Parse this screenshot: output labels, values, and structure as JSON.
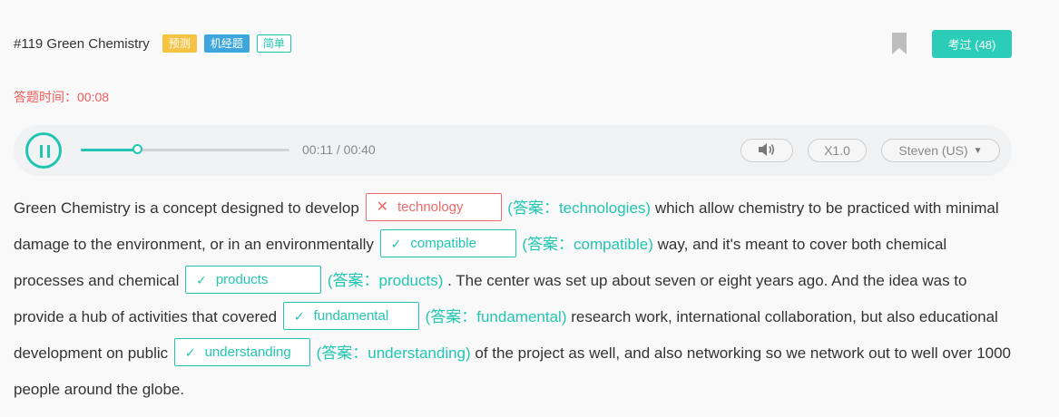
{
  "header": {
    "title": "#119 Green Chemistry",
    "tags": [
      {
        "label": "预测",
        "type": "predict"
      },
      {
        "label": "机经题",
        "type": "machine"
      },
      {
        "label": "简单",
        "type": "simple"
      }
    ],
    "exam_button_label": "考过 (48)"
  },
  "timer": {
    "label": "答题时间：00:08"
  },
  "player": {
    "state": "playing",
    "progress": 0.275,
    "time_display": "00:11 / 00:40",
    "speed_label": "X1.0",
    "voice_label": "Steven (US)"
  },
  "passage": {
    "segments": {
      "s0": "Green Chemistry is a concept designed to develop",
      "s1": "which allow chemistry to be practiced with minimal damage to the environment, or in an environmentally",
      "s2": "way, and it's meant to cover both chemical processes and chemical",
      "s3": ". The center was set up about seven or eight years ago. And the idea was to provide a hub of activities that covered",
      "s4": "research work, international collaboration, but also educational development on public",
      "s5": "of the project as well, and also networking so we network out to well over 1000 people around the globe."
    },
    "blanks": [
      {
        "user": "technology",
        "answer": "(答案：technologies)",
        "correct": false
      },
      {
        "user": "compatible",
        "answer": "(答案：compatible)",
        "correct": true
      },
      {
        "user": "products",
        "answer": "(答案：products)",
        "correct": true
      },
      {
        "user": "fundamental",
        "answer": "(答案：fundamental)",
        "correct": true
      },
      {
        "user": "understanding",
        "answer": "(答案：understanding)",
        "correct": true
      }
    ],
    "marks": {
      "correct": "✓",
      "wrong": "✕"
    }
  },
  "colors": {
    "accent": "#22c5b2",
    "error": "#ef6a6a",
    "timer": "#ef5a5a",
    "tag_predict": "#f5c242",
    "tag_machine": "#3da6dd"
  }
}
